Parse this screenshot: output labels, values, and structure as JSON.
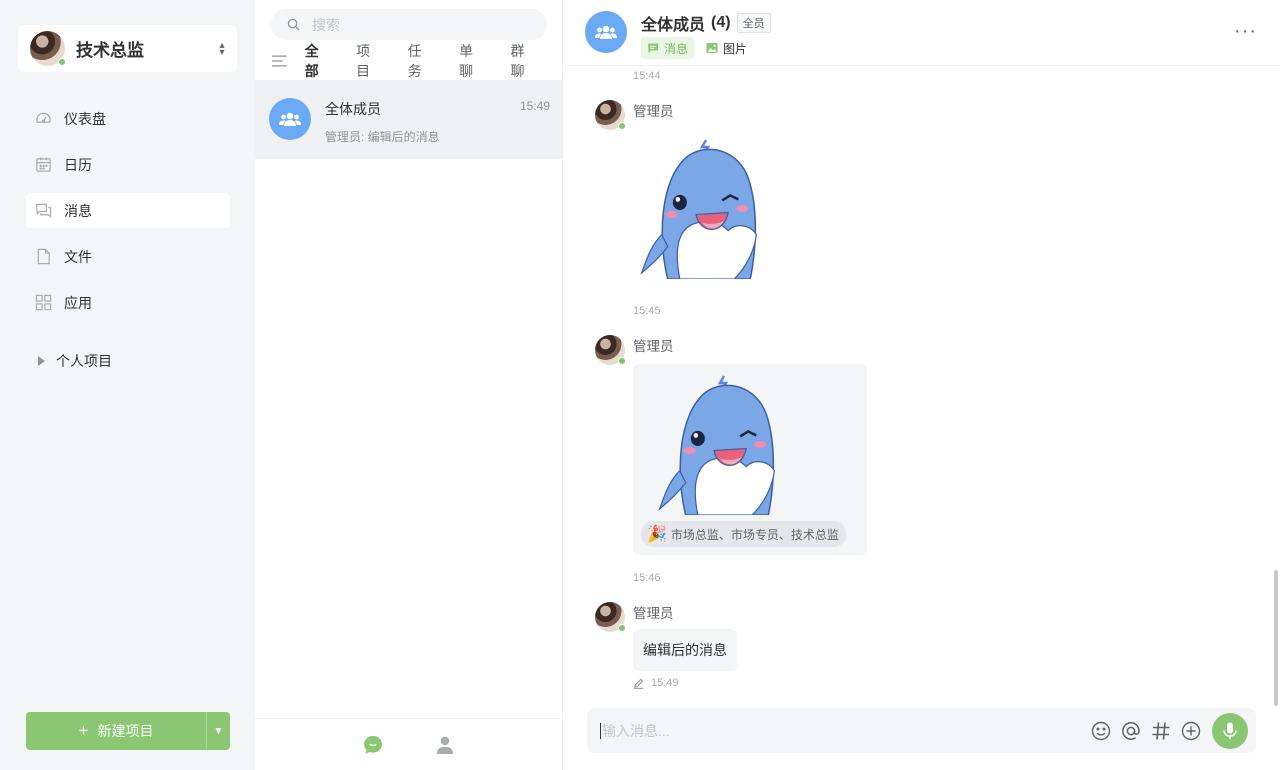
{
  "sidebar": {
    "user": {
      "name": "技术总监",
      "status": "online"
    },
    "nav": [
      {
        "label": "仪表盘",
        "icon": "dashboard-icon"
      },
      {
        "label": "日历",
        "icon": "calendar-icon"
      },
      {
        "label": "消息",
        "icon": "message-icon",
        "active": true
      },
      {
        "label": "文件",
        "icon": "file-icon"
      },
      {
        "label": "应用",
        "icon": "apps-icon"
      }
    ],
    "personal_projects": "个人项目",
    "new_project": {
      "plus": "+",
      "label": "新建项目"
    }
  },
  "conversations": {
    "search_placeholder": "搜索",
    "filters": [
      "全部",
      "项目",
      "任务",
      "单聊",
      "群聊"
    ],
    "active_filter": "全部",
    "items": [
      {
        "name": "全体成员",
        "time": "15:49",
        "preview": "管理员: 编辑后的消息"
      }
    ]
  },
  "chat": {
    "title": "全体成员",
    "count": "(4)",
    "badge": "全员",
    "tabs": [
      {
        "label": "消息",
        "active": true
      },
      {
        "label": "图片",
        "active": false
      }
    ],
    "more": "···",
    "messages": [
      {
        "time_above": "15:44",
        "sender": "管理员",
        "type": "sticker",
        "time": "15:45"
      },
      {
        "sender": "管理员",
        "type": "sticker_with_reaction",
        "reaction": "市场总监、市场专员、技术总监",
        "time": "15:46"
      },
      {
        "sender": "管理员",
        "type": "text",
        "text": "编辑后的消息",
        "time": "15:49",
        "edited": true
      }
    ],
    "composer_placeholder": "输入消息..."
  },
  "colors": {
    "accent": "#8bc773",
    "group_avatar": "#6aa9f3",
    "sticker_blue": "#7ba7e6",
    "sidebar_bg": "#f4f5f7"
  }
}
